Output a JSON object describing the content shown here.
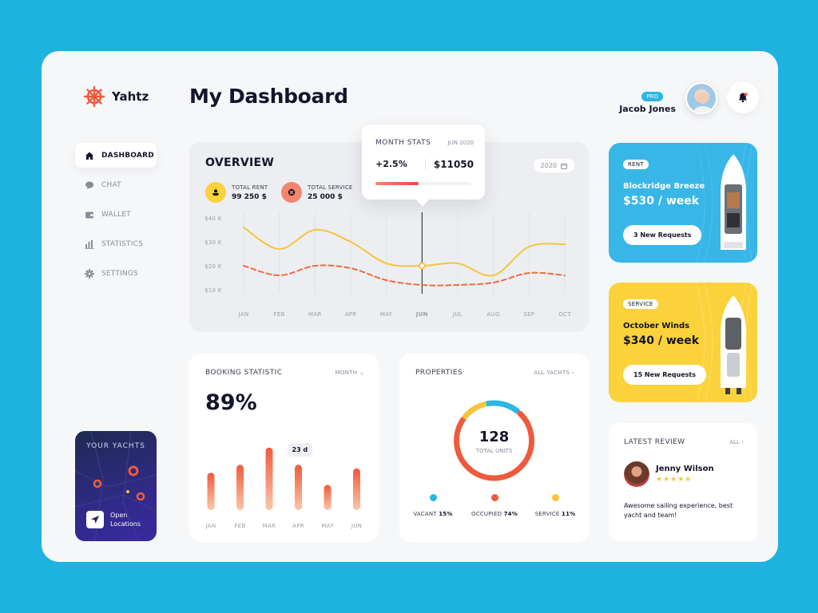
{
  "brand": {
    "name": "Yahtz",
    "accent": "#f05a3c"
  },
  "sidebar": {
    "items": [
      {
        "label": "DASHBOARD",
        "icon": "home-icon",
        "active": true
      },
      {
        "label": "CHAT",
        "icon": "chat-icon"
      },
      {
        "label": "WALLET",
        "icon": "wallet-icon"
      },
      {
        "label": "STATISTICS",
        "icon": "statistics-icon"
      },
      {
        "label": "SETTINGS",
        "icon": "gear-icon"
      }
    ],
    "yachts_card": {
      "title": "YOUR YACHTS",
      "action": "Open\nLocations"
    }
  },
  "header": {
    "title": "My Dashboard",
    "user": {
      "badge": "PRO",
      "name": "Jacob Jones"
    }
  },
  "overview": {
    "title": "OVERVIEW",
    "year": "2020",
    "stats": [
      {
        "label": "TOTAL RENT",
        "value": "99 250 $",
        "color": "#fbd23b"
      },
      {
        "label": "TOTAL SERVICE",
        "value": "25 000 $",
        "color": "#f5856f"
      }
    ],
    "tooltip": {
      "title": "MONTH STATS",
      "date": "JUN 2020",
      "change": "+2.5%",
      "amount": "$11050",
      "progress": 0.45
    }
  },
  "chart_data": {
    "type": "line",
    "categories": [
      "JAN",
      "FEB",
      "MAR",
      "APR",
      "MAY",
      "JUN",
      "JUL",
      "AUG",
      "SEP",
      "OCT"
    ],
    "highlight": "JUN",
    "y_ticks": [
      "$10 K",
      "$20 K",
      "$30 K",
      "$40 K"
    ],
    "ylim": [
      10,
      40
    ],
    "series": [
      {
        "color": "#f6c43d",
        "style": "solid",
        "values": [
          36,
          27,
          35,
          30,
          21,
          20,
          21,
          16,
          28,
          29
        ]
      },
      {
        "color": "#f36a3e",
        "style": "dashed",
        "values": [
          20,
          16,
          20,
          19,
          14,
          12,
          12,
          13,
          17,
          16
        ]
      }
    ]
  },
  "booking": {
    "title": "BOOKING STATISTIC",
    "period": "MONTH",
    "percent": "89%",
    "tip": "23 d",
    "bars": [
      {
        "label": "JAN",
        "value": 52
      },
      {
        "label": "FEB",
        "value": 63
      },
      {
        "label": "MAR",
        "value": 87
      },
      {
        "label": "APR",
        "value": 63
      },
      {
        "label": "MAY",
        "value": 35
      },
      {
        "label": "JUN",
        "value": 58
      }
    ]
  },
  "properties": {
    "title": "PROPERTIES",
    "link": "ALL YACHTS",
    "total": "128",
    "total_label": "TOTAL UNITS",
    "segments": [
      {
        "label": "VACANT",
        "value": "15%",
        "pct": 15,
        "color": "#2bb5e6"
      },
      {
        "label": "OCCUPIED",
        "value": "74%",
        "pct": 74,
        "color": "#f05a3c"
      },
      {
        "label": "SERVICE",
        "value": "11%",
        "pct": 11,
        "color": "#f6c43d"
      }
    ]
  },
  "promos": [
    {
      "tag": "RENT",
      "name": "Blockridge Breeze",
      "price": "$530 / week",
      "button": "3 New Requests"
    },
    {
      "tag": "SERVICE",
      "name": "October Winds",
      "price": "$340 / week",
      "button": "15 New Requests"
    }
  ],
  "review": {
    "title": "LATEST REVIEW",
    "link": "ALL",
    "name": "Jenny Wilson",
    "rating": 5,
    "stars": "★★★★★",
    "text": "Awesome sailing experience, best yacht and team!"
  }
}
